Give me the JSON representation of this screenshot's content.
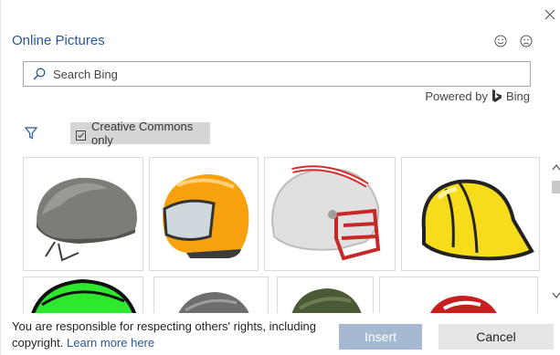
{
  "dialog": {
    "title": "Online Pictures",
    "close_icon": "close-icon",
    "feedback_icons": [
      "smile-icon",
      "frown-icon"
    ]
  },
  "search": {
    "placeholder": "Search Bing",
    "value": ""
  },
  "powered_by": {
    "label": "Powered by",
    "brand": "Bing"
  },
  "filter": {
    "icon": "filter-icon",
    "creative_commons_label": "Creative Commons only",
    "creative_commons_checked": true
  },
  "results": {
    "items": [
      {
        "subject": "gray military helmet"
      },
      {
        "subject": "orange motorcycle helmet"
      },
      {
        "subject": "white football helmet with red facemask"
      },
      {
        "subject": "yellow hard hat"
      },
      {
        "subject": "green helmet"
      },
      {
        "subject": "gray helmet"
      },
      {
        "subject": "olive military helmet"
      },
      {
        "subject": "red helmet"
      }
    ]
  },
  "footer": {
    "notice": "You are responsible for respecting others' rights, including copyright.",
    "learn_more": "Learn more here",
    "insert_label": "Insert",
    "cancel_label": "Cancel"
  },
  "colors": {
    "accent": "#2b579a",
    "insert_disabled": "#a6b9d2",
    "cancel_bg": "#e6e6e6",
    "chip_bg": "#d6d6d6"
  }
}
